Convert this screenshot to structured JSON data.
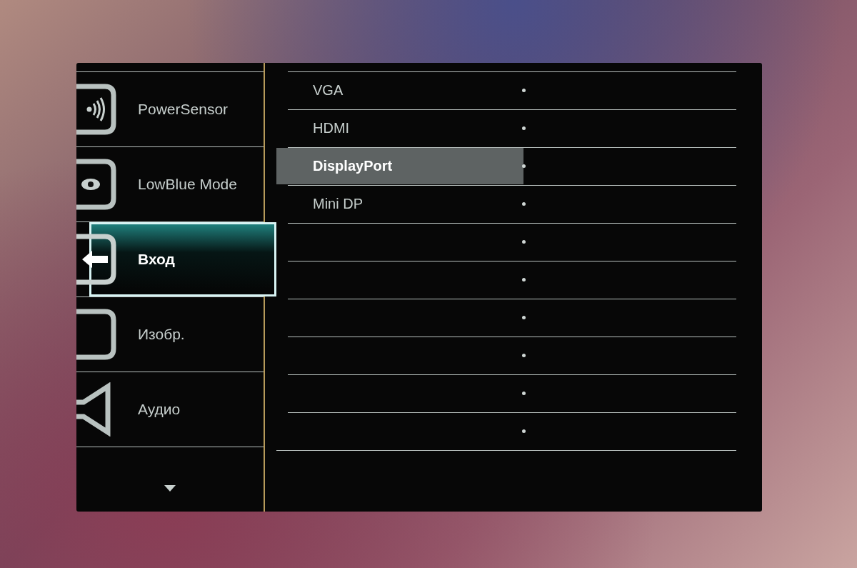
{
  "menu": {
    "items": [
      {
        "label": "PowerSensor",
        "kind": "sensor",
        "selected": false
      },
      {
        "label": "LowBlue Mode",
        "kind": "eye",
        "selected": false
      },
      {
        "label": "Вход",
        "kind": "input",
        "selected": true
      },
      {
        "label": "Изобр.",
        "kind": "picture",
        "selected": false
      },
      {
        "label": "Аудио",
        "kind": "audio",
        "selected": false
      }
    ]
  },
  "inputs": {
    "rows": [
      {
        "label": "VGA",
        "selected": false
      },
      {
        "label": "HDMI",
        "selected": false
      },
      {
        "label": "DisplayPort",
        "selected": true
      },
      {
        "label": "Mini DP",
        "selected": false
      },
      {
        "selected": false
      },
      {
        "selected": false
      },
      {
        "selected": false
      },
      {
        "selected": false
      },
      {
        "selected": false
      },
      {
        "selected": false
      }
    ]
  }
}
